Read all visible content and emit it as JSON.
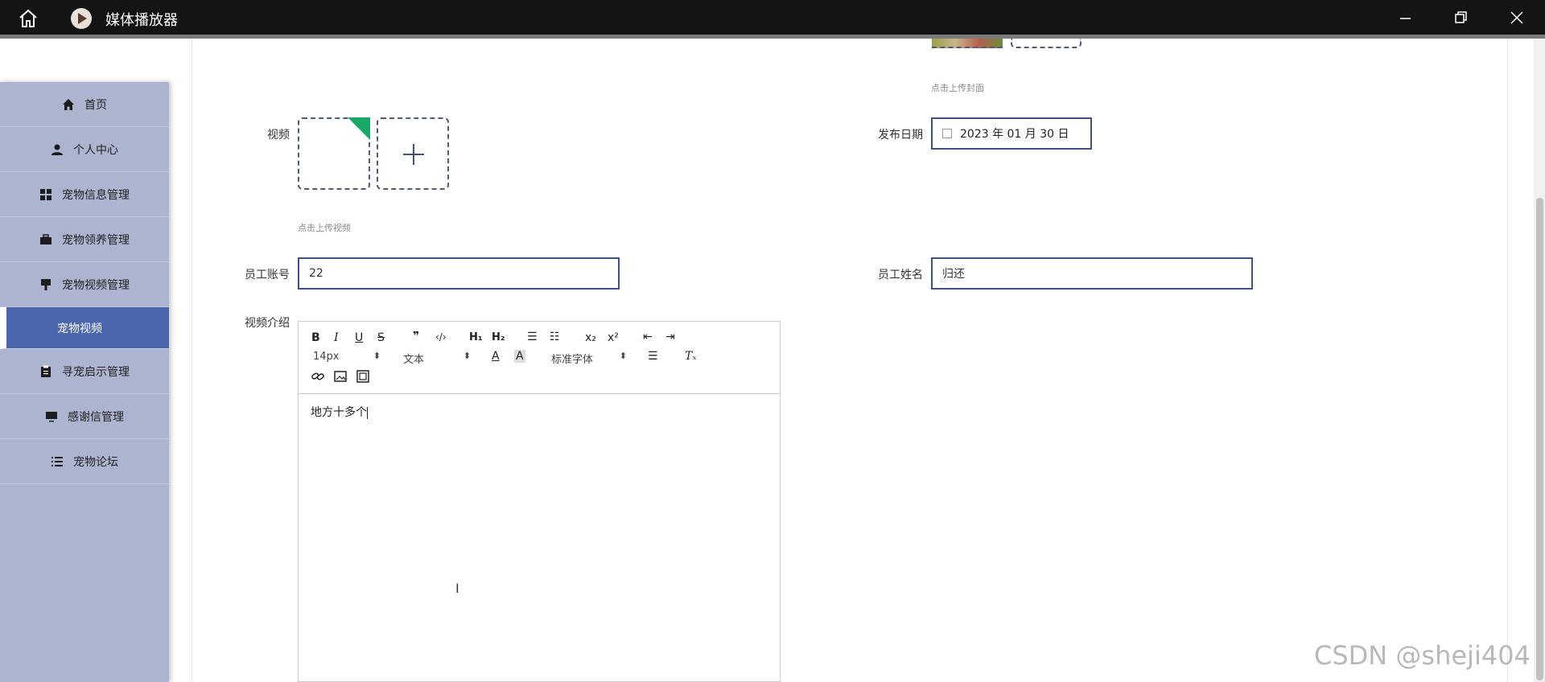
{
  "window": {
    "title": "媒体播放器"
  },
  "sidebar": {
    "items": [
      {
        "label": "首页",
        "icon": "home-icon"
      },
      {
        "label": "个人中心",
        "icon": "user-icon"
      },
      {
        "label": "宠物信息管理",
        "icon": "grid-icon"
      },
      {
        "label": "宠物领养管理",
        "icon": "briefcase-icon"
      },
      {
        "label": "宠物视频管理",
        "icon": "brush-icon"
      },
      {
        "label": "宠物视频",
        "icon": ""
      },
      {
        "label": "寻宠启示管理",
        "icon": "clipboard-icon"
      },
      {
        "label": "感谢信管理",
        "icon": "monitor-icon"
      },
      {
        "label": "宠物论坛",
        "icon": "list-icon"
      }
    ],
    "active_sub": "宠物视频"
  },
  "form": {
    "cover_hint": "点击上传封面",
    "video_label": "视频",
    "video_hint": "点击上传视频",
    "publish_date_label": "发布日期",
    "publish_date_value": "2023 年 01 月 30 日",
    "employee_account_label": "员工账号",
    "employee_account_value": "22",
    "employee_name_label": "员工姓名",
    "employee_name_value": "归还",
    "video_intro_label": "视频介绍"
  },
  "editor": {
    "font_size": "14px",
    "header_select": "文本",
    "font_select": "标准字体",
    "content": "地方十多个"
  },
  "watermark": "CSDN @sheji404"
}
